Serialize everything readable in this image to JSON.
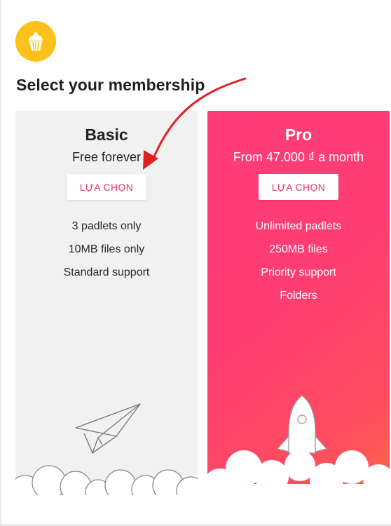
{
  "header": {
    "logo_icon": "cupcake-icon",
    "title": "Select your membership"
  },
  "plans": {
    "basic": {
      "name": "Basic",
      "price": "Free forever",
      "button_label": "LỰA CHỌN",
      "features": [
        "3 padlets only",
        "10MB files only",
        "Standard support"
      ],
      "illustration": "paper-plane-icon"
    },
    "pro": {
      "name": "Pro",
      "price": "From 47.000 ₫ a month",
      "button_label": "LỰA CHỌN",
      "features": [
        "Unlimited padlets",
        "250MB files",
        "Priority support",
        "Folders"
      ],
      "illustration": "rocket-icon"
    }
  },
  "colors": {
    "accent": "#e8336d",
    "logo_bg": "#fcc21b",
    "pro_gradient_start": "#fe3b7a",
    "pro_gradient_end": "#ff6b45",
    "basic_bg": "#f1f1f1",
    "annotation_arrow": "#e0201e"
  }
}
